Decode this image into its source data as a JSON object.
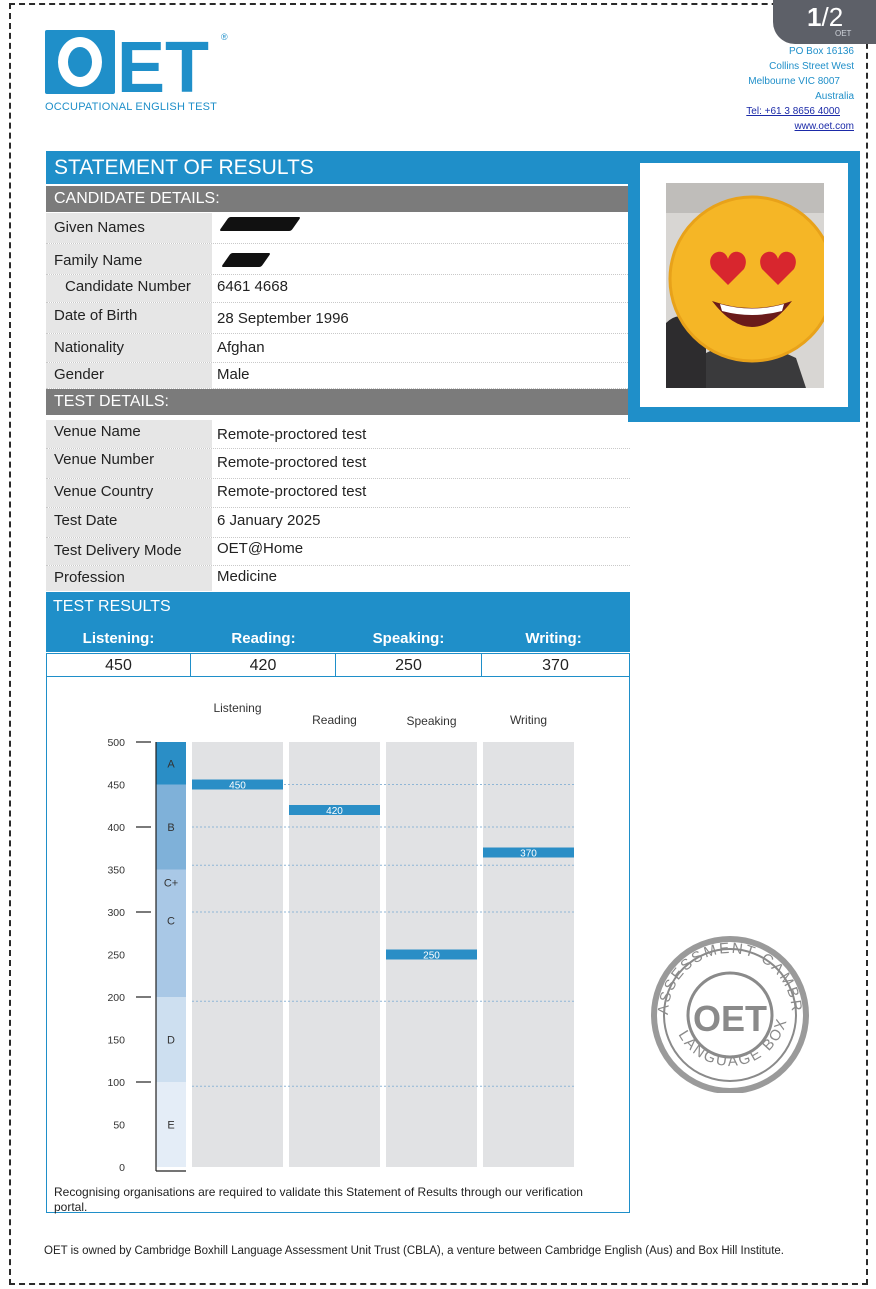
{
  "page_indicator": {
    "current": "1",
    "total": "/2",
    "sub": "OET"
  },
  "header": {
    "logo_text": "OET",
    "logo_subtitle": "OCCUPATIONAL ENGLISH TEST",
    "address": [
      "PO Box 16136",
      "Collins Street West",
      "Melbourne VIC 8007",
      "Australia"
    ],
    "tel": "Tel: +61 3 8656 4000",
    "web": "www.oet.com"
  },
  "title": "STATEMENT OF RESULTS",
  "candidate": {
    "heading": "CANDIDATE DETAILS:",
    "given_names_label": "Given Names",
    "family_name_label": "Family Name",
    "candidate_number_label": "Candidate Number",
    "candidate_number": "6461 4668",
    "dob_label": "Date of Birth",
    "dob": "28 September 1996",
    "nationality_label": "Nationality",
    "nationality": "Afghan",
    "gender_label": "Gender",
    "gender": "Male"
  },
  "test": {
    "heading": "TEST DETAILS:",
    "venue_name_label": "Venue Name",
    "venue_name": "Remote-proctored test",
    "venue_number_label": "Venue Number",
    "venue_number": "Remote-proctored test",
    "venue_country_label": "Venue Country",
    "venue_country": "Remote-proctored test",
    "test_date_label": "Test Date",
    "test_date": "6 January 2025",
    "delivery_mode_label": "Test Delivery Mode",
    "delivery_mode": "OET@Home",
    "profession_label": "Profession",
    "profession": "Medicine"
  },
  "results": {
    "heading": "TEST RESULTS",
    "scores": [
      {
        "label": "Listening:",
        "value": "450"
      },
      {
        "label": "Reading:",
        "value": "420"
      },
      {
        "label": "Speaking:",
        "value": "250"
      },
      {
        "label": "Writing:",
        "value": "370"
      }
    ]
  },
  "chart_data": {
    "type": "bar",
    "categories": [
      "Listening",
      "Reading",
      "Speaking",
      "Writing"
    ],
    "values": [
      450,
      420,
      250,
      370
    ],
    "ylim": [
      0,
      500
    ],
    "yticks": [
      "500",
      "450",
      "400",
      "350",
      "300",
      "250",
      "200",
      "150",
      "100",
      "50",
      "0"
    ],
    "grades": [
      {
        "grade": "A",
        "from": 450,
        "to": 500,
        "color": "#2a8ec6"
      },
      {
        "grade": "B",
        "from": 350,
        "to": 450,
        "color": "#7fb1d9"
      },
      {
        "grade": "C+",
        "from": 300,
        "to": 350,
        "color": "#a9c8e6"
      },
      {
        "grade": "C",
        "from": 200,
        "to": 300,
        "color": "#a9c8e6"
      },
      {
        "grade": "D",
        "from": 100,
        "to": 200,
        "color": "#cddff0"
      },
      {
        "grade": "E",
        "from": 0,
        "to": 100,
        "color": "#e4edf7"
      }
    ],
    "grid": true,
    "bar_color": "#2a8ec6",
    "column_color": "#e1e2e4"
  },
  "footnote": "Recognising organisations are required to validate this Statement of Results through our verification portal.",
  "footer": "OET is owned by Cambridge Boxhill Language Assessment Unit Trust (CBLA), a venture between Cambridge English (Aus) and Box Hill Institute.",
  "seal": {
    "center": "OET",
    "text_top": "CAMBRIDGE",
    "text_left": "ASSESSMENT",
    "text_right": "BOXHILL",
    "text_bottom": "LANGUAGE"
  },
  "colors": {
    "brand_blue": "#1f8fc9",
    "section_grey": "#7b7b7b"
  }
}
